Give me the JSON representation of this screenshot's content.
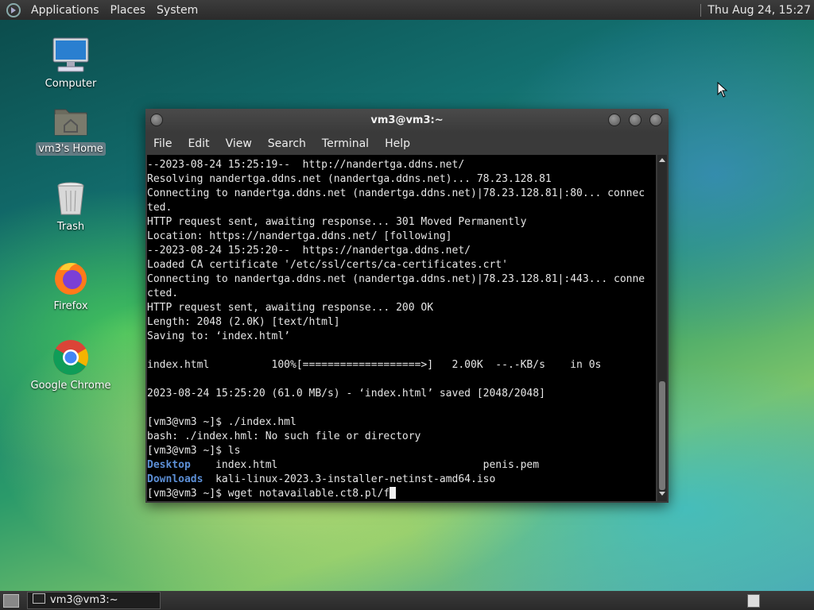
{
  "top_panel": {
    "menus": [
      "Applications",
      "Places",
      "System"
    ],
    "clock": "Thu Aug 24, 15:27"
  },
  "desktop_icons": [
    {
      "label": "Computer",
      "icon": "computer-icon"
    },
    {
      "label": "vm3's Home",
      "icon": "home-folder-icon"
    },
    {
      "label": "Trash",
      "icon": "trash-icon"
    },
    {
      "label": "Firefox",
      "icon": "firefox-icon"
    },
    {
      "label": "Google Chrome",
      "icon": "chrome-icon"
    }
  ],
  "terminal": {
    "title": "vm3@vm3:~",
    "menu": [
      "File",
      "Edit",
      "View",
      "Search",
      "Terminal",
      "Help"
    ],
    "lines": [
      "--2023-08-24 15:25:19--  http://nandertga.ddns.net/",
      "Resolving nandertga.ddns.net (nandertga.ddns.net)... 78.23.128.81",
      "Connecting to nandertga.ddns.net (nandertga.ddns.net)|78.23.128.81|:80... connec",
      "ted.",
      "HTTP request sent, awaiting response... 301 Moved Permanently",
      "Location: https://nandertga.ddns.net/ [following]",
      "--2023-08-24 15:25:20--  https://nandertga.ddns.net/",
      "Loaded CA certificate '/etc/ssl/certs/ca-certificates.crt'",
      "Connecting to nandertga.ddns.net (nandertga.ddns.net)|78.23.128.81|:443... conne",
      "cted.",
      "HTTP request sent, awaiting response... 200 OK",
      "Length: 2048 (2.0K) [text/html]",
      "Saving to: ‘index.html’",
      "",
      "index.html          100%[===================>]   2.00K  --.-KB/s    in 0s",
      "",
      "2023-08-24 15:25:20 (61.0 MB/s) - ‘index.html’ saved [2048/2048]",
      "",
      "[vm3@vm3 ~]$ ./index.hml",
      "bash: ./index.hml: No such file or directory",
      "[vm3@vm3 ~]$ ls"
    ],
    "ls_rows": [
      {
        "dir": "Desktop",
        "rest": "    index.html                                 penis.pem"
      },
      {
        "dir": "Downloads",
        "rest": "  kali-linux-2023.3-installer-netinst-amd64.iso"
      }
    ],
    "prompt": "[vm3@vm3 ~]$ ",
    "current_input": "wget notavailable.ct8.pl/f"
  },
  "bottom_panel": {
    "task_label": "vm3@vm3:~"
  }
}
